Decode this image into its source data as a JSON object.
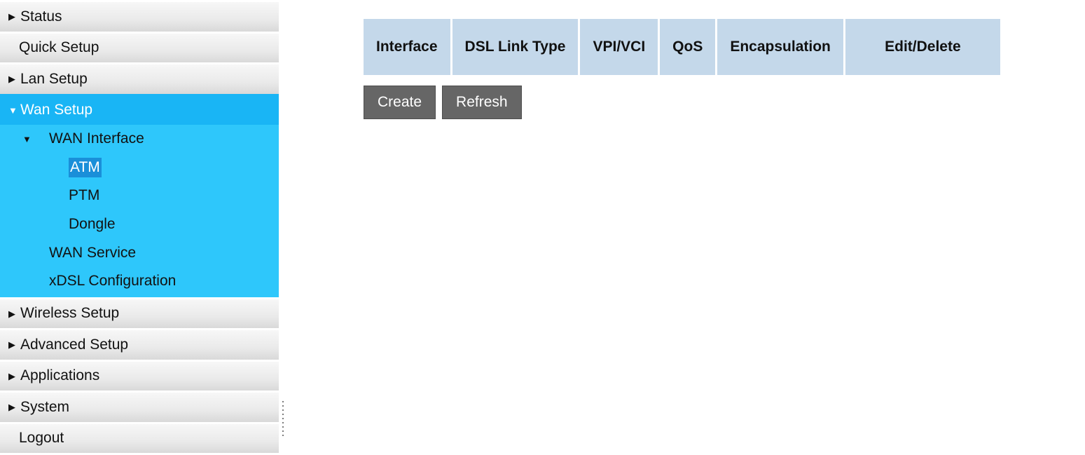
{
  "sidebar": {
    "status": "Status",
    "quick_setup": "Quick Setup",
    "lan_setup": "Lan Setup",
    "wan_setup": "Wan Setup",
    "wan_interface": "WAN Interface",
    "atm": "ATM",
    "ptm": "PTM",
    "dongle": "Dongle",
    "wan_service": "WAN Service",
    "xdsl_configuration": "xDSL Configuration",
    "wireless_setup": "Wireless Setup",
    "advanced_setup": "Advanced Setup",
    "applications": "Applications",
    "system": "System",
    "logout": "Logout",
    "arrow_collapsed": "▶",
    "arrow_expanded": "▼"
  },
  "table": {
    "headers": [
      "Interface",
      "DSL Link Type",
      "VPI/VCI",
      "QoS",
      "Encapsulation",
      "Edit/Delete"
    ]
  },
  "buttons": {
    "create": "Create",
    "refresh": "Refresh"
  },
  "colors": {
    "active_nav": "#19b5f5",
    "submenu_bg": "#2ec7fb",
    "selected_item": "#1a8fd9",
    "table_header": "#c4d8ea",
    "button_bg": "#666666"
  }
}
